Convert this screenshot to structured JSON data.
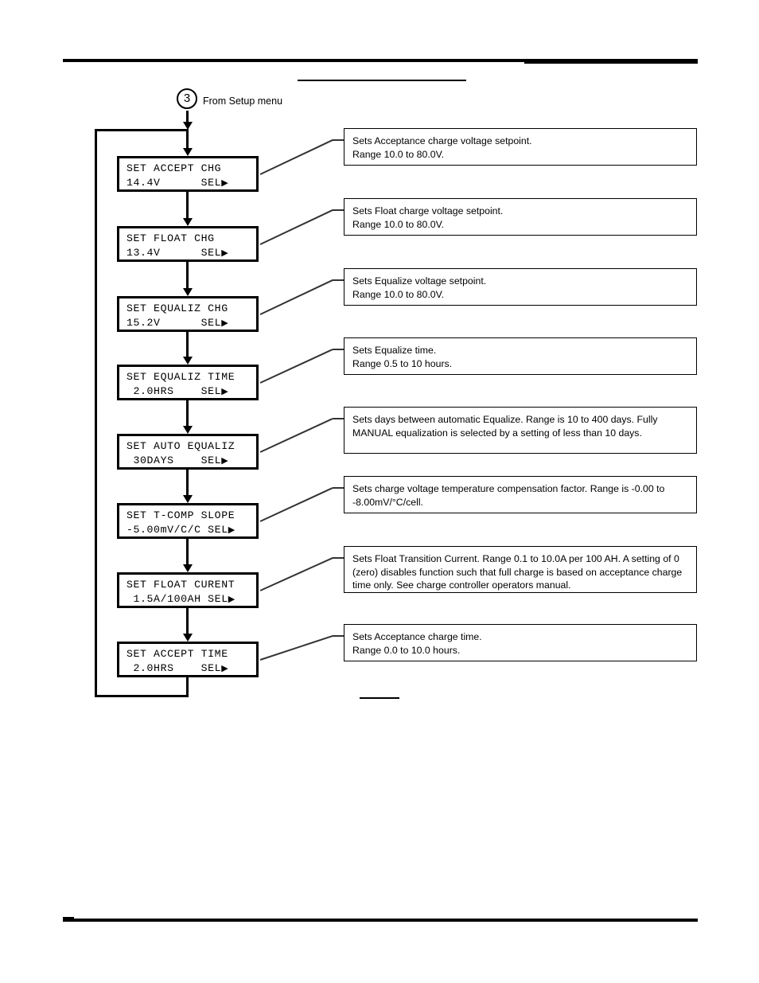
{
  "page": {
    "entry_marker": "3",
    "entry_label": "From Setup menu"
  },
  "flow": {
    "steps": [
      {
        "name": "set-accept-chg",
        "lcd_line1": "SET ACCEPT CHG",
        "lcd_line2": "14.4V      SEL",
        "desc_line1": "Sets Acceptance charge voltage setpoint.",
        "desc_line2": "Range 10.0 to 80.0V."
      },
      {
        "name": "set-float-chg",
        "lcd_line1": "SET FLOAT CHG",
        "lcd_line2": "13.4V      SEL",
        "desc_line1": "Sets Float charge voltage setpoint.",
        "desc_line2": "Range 10.0 to 80.0V."
      },
      {
        "name": "set-equaliz-chg",
        "lcd_line1": "SET EQUALIZ CHG",
        "lcd_line2": "15.2V      SEL",
        "desc_line1": "Sets Equalize voltage setpoint.",
        "desc_line2": "Range 10.0 to 80.0V."
      },
      {
        "name": "set-equaliz-time",
        "lcd_line1": "SET EQUALIZ TIME",
        "lcd_line2": " 2.0HRS    SEL",
        "desc_line1": "Sets Equalize time.",
        "desc_line2": "Range 0.5 to 10 hours."
      },
      {
        "name": "set-auto-equaliz",
        "lcd_line1": "SET AUTO EQUALIZ",
        "lcd_line2": " 30DAYS    SEL",
        "desc_line1": "Sets days between automatic Equalize. Range is 10 to 400 days. Fully MANUAL equalization is selected by a setting of less than 10 days.",
        "desc_line2": ""
      },
      {
        "name": "set-t-comp-slope",
        "lcd_line1": "SET T-COMP SLOPE",
        "lcd_line2": "-5.00mV/C/C SEL",
        "desc_line1": "Sets charge voltage temperature compensation factor. Range is -0.00 to -8.00mV/°C/cell.",
        "desc_line2": ""
      },
      {
        "name": "set-float-curent",
        "lcd_line1": "SET FLOAT CURENT",
        "lcd_line2": " 1.5A/100AH SEL",
        "desc_line1": "Sets Float Transition Current. Range 0.1 to 10.0A per 100 AH. A setting of 0 (zero) disables function such that full charge is based on acceptance charge time only. See charge controller operators manual.",
        "desc_line2": ""
      },
      {
        "name": "set-accept-time",
        "lcd_line1": "SET ACCEPT TIME",
        "lcd_line2": " 2.0HRS    SEL",
        "desc_line1": "Sets Acceptance charge time.",
        "desc_line2": "Range 0.0 to 10.0 hours."
      }
    ],
    "sel_arrow_glyph": "▶"
  }
}
